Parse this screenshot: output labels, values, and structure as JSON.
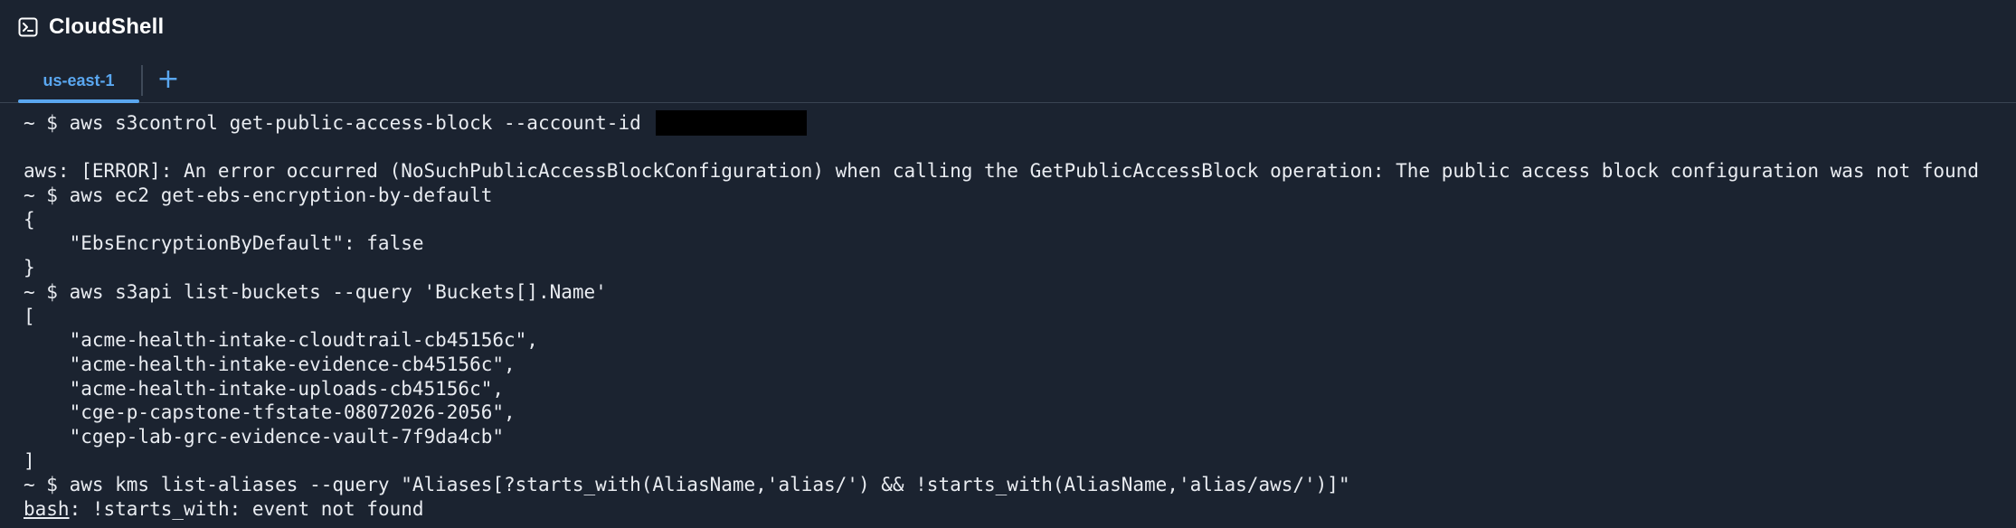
{
  "app": {
    "title": "CloudShell",
    "icon": "terminal-icon"
  },
  "tabs": [
    {
      "label": "us-east-1",
      "active": true
    }
  ],
  "add_tab": {
    "label": "+"
  },
  "terminal": {
    "lines": [
      "~ $ aws s3control get-public-access-block --account-id ",
      "",
      "aws: [ERROR]: An error occurred (NoSuchPublicAccessBlockConfiguration) when calling the GetPublicAccessBlock operation: The public access block configuration was not found",
      "~ $ aws ec2 get-ebs-encryption-by-default",
      "{",
      "    \"EbsEncryptionByDefault\": false",
      "}",
      "~ $ aws s3api list-buckets --query 'Buckets[].Name'",
      "[",
      "    \"acme-health-intake-cloudtrail-cb45156c\",",
      "    \"acme-health-intake-evidence-cb45156c\",",
      "    \"acme-health-intake-uploads-cb45156c\",",
      "    \"cge-p-capstone-tfstate-08072026-2056\",",
      "    \"cgep-lab-grc-evidence-vault-7f9da4cb\"",
      "]",
      "~ $ aws kms list-aliases --query \"Aliases[?starts_with(AliasName,'alias/') && !starts_with(AliasName,'alias/aws/')]\"",
      "bash",
      ": !starts_with: event not found"
    ]
  },
  "colors": {
    "background": "#1b2330",
    "accent": "#5aa7f0",
    "text": "#e9ecf1",
    "divider": "#3a4452"
  }
}
